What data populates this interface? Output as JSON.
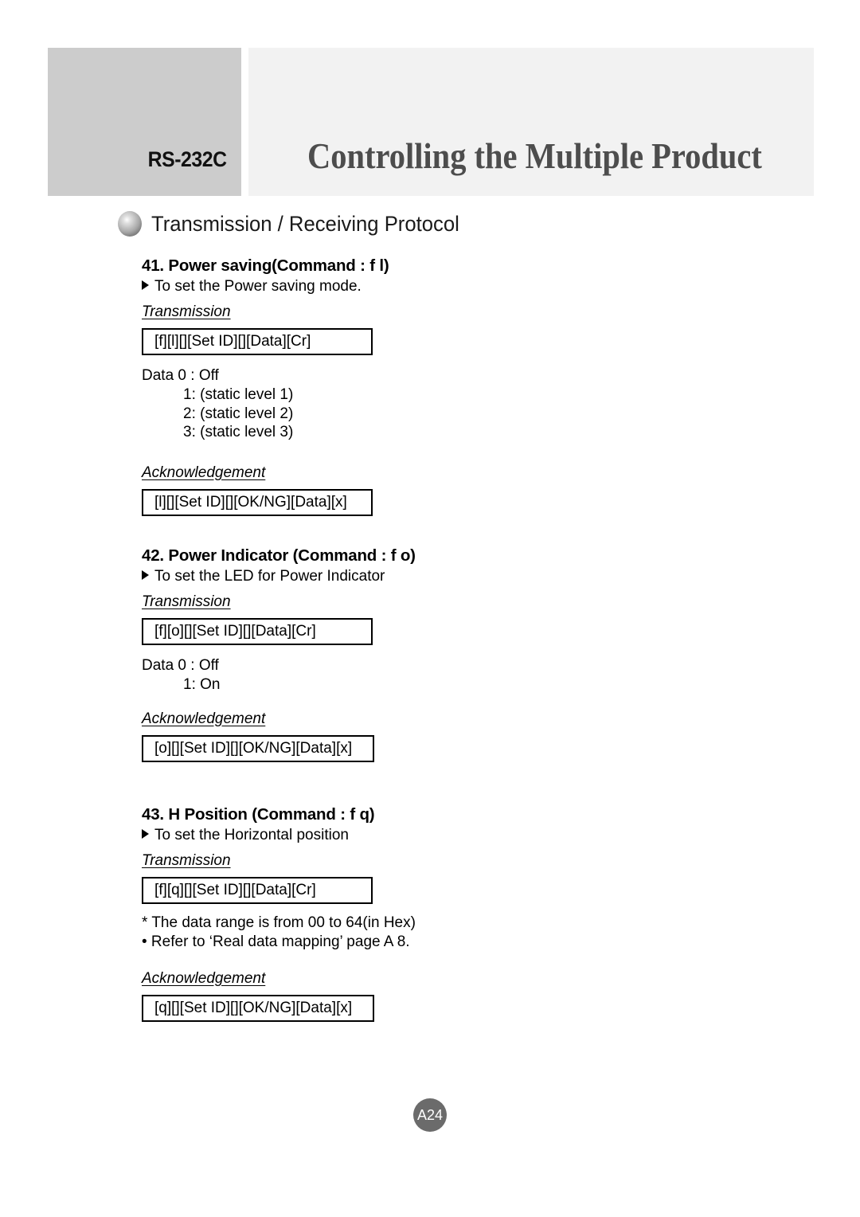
{
  "header": {
    "tab_label": "RS-232C",
    "title": "Controlling the Multiple Product",
    "tab_color": "#cccccc",
    "panel_color": "#f2f2f2",
    "title_color": "#4d4d4d"
  },
  "protocol_heading": {
    "bullet_icon": "sphere-bullet-icon",
    "text": "Transmission / Receiving Protocol"
  },
  "labels": {
    "transmission": "Transmission",
    "acknowledgement": "Acknowledgement"
  },
  "sections": [
    {
      "title": "41. Power saving(Command : f l)",
      "description": "To set the Power saving mode.",
      "transmission_command": "[f][l][][Set ID][][Data][Cr]",
      "data_lines": [
        "Data 0 : Off",
        "1: (static level 1)",
        "2: (static level 2)",
        "3: (static level 3)"
      ],
      "notes": [],
      "acknowledgement_command": "[l][][Set ID][][OK/NG][Data][x]"
    },
    {
      "title": "42. Power Indicator (Command : f o)",
      "description": "To set the LED for Power Indicator",
      "transmission_command": "[f][o][][Set ID][][Data][Cr]",
      "data_lines": [
        "Data 0 : Off",
        "1: On"
      ],
      "notes": [],
      "acknowledgement_command": "[o][][Set ID][][OK/NG][Data][x]"
    },
    {
      "title": "43. H Position (Command : f q)",
      "description": "To set the Horizontal position",
      "transmission_command": "[f][q][][Set ID][][Data][Cr]",
      "data_lines": [],
      "notes": [
        "* The data range is from 00 to 64(in Hex)",
        "• Refer to ‘Real data mapping’ page A 8."
      ],
      "acknowledgement_command": "[q][][Set ID][][OK/NG][Data][x]"
    }
  ],
  "footer": {
    "page_number": "A24",
    "badge_color": "#6b6b6b"
  }
}
